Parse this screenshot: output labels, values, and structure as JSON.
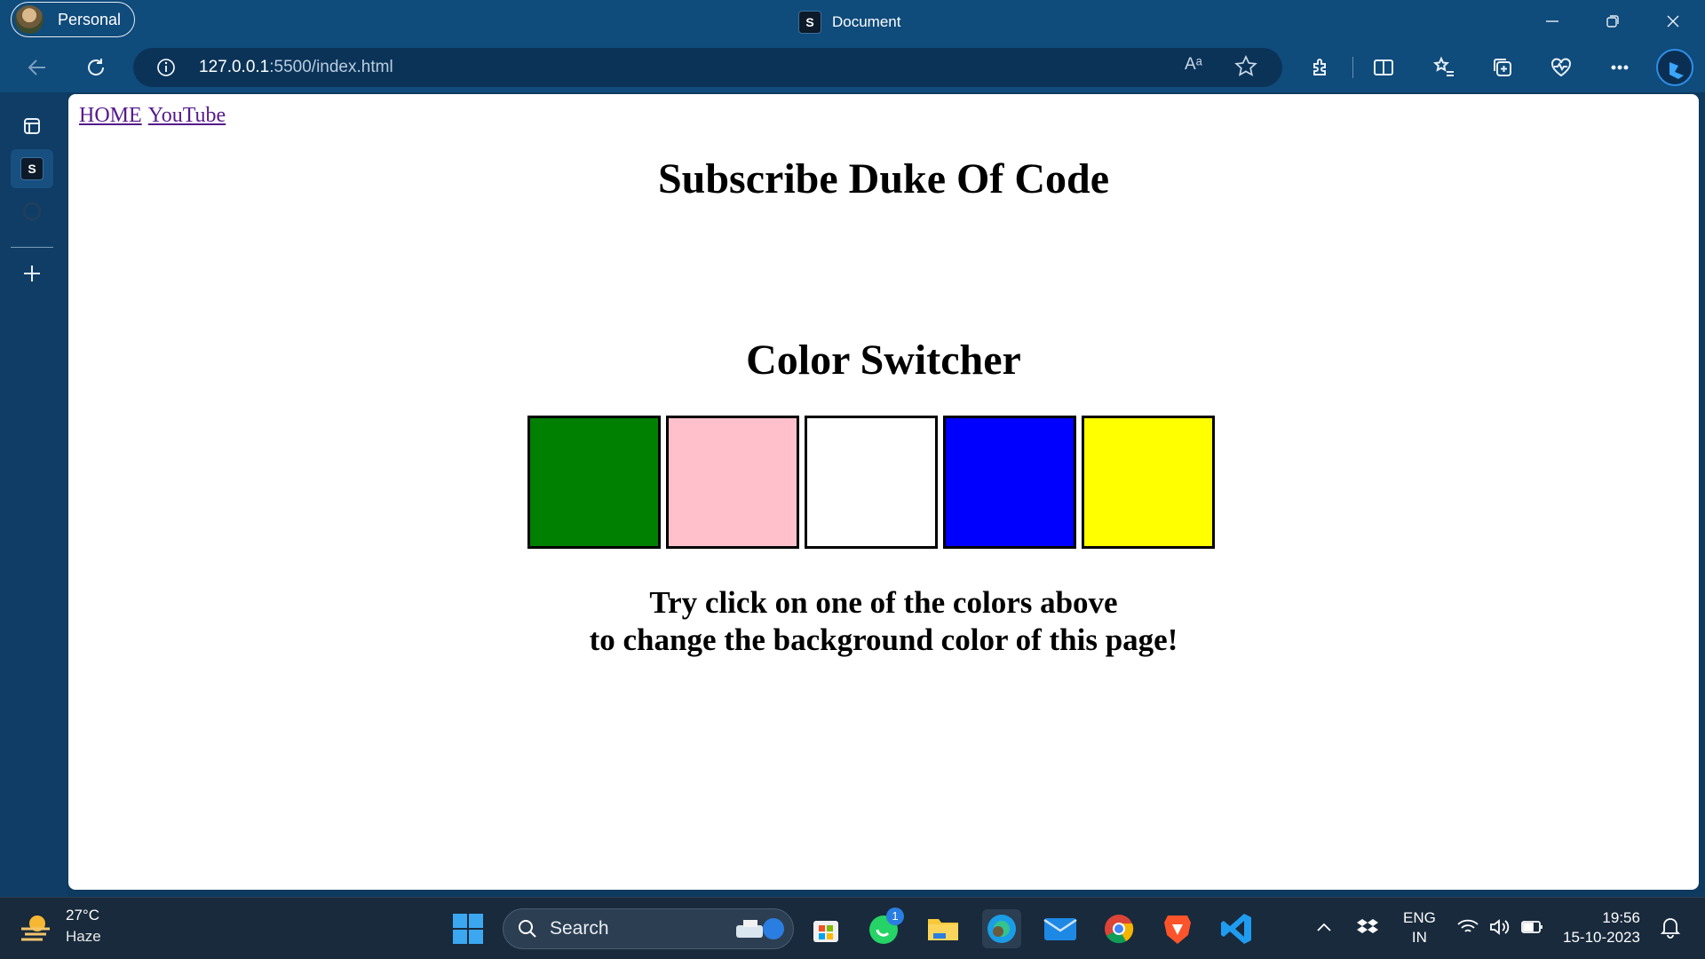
{
  "browser": {
    "profile_label": "Personal",
    "tab_title": "Document",
    "favicon_letter": "S",
    "url_host": "127.0.0.1",
    "url_rest": ":5500/index.html",
    "read_aloud_glyph": "Aᵃ"
  },
  "page": {
    "nav_links": [
      "HOME",
      "YouTube"
    ],
    "heading": "Subscribe Duke Of Code",
    "switcher_heading": "Color Switcher",
    "swatches": [
      {
        "name": "green",
        "color": "#008000"
      },
      {
        "name": "pink",
        "color": "#ffc0cb"
      },
      {
        "name": "white",
        "color": "#ffffff"
      },
      {
        "name": "blue",
        "color": "#0000ff"
      },
      {
        "name": "yellow",
        "color": "#ffff00"
      }
    ],
    "instructions_line1": "Try click on one of the colors above",
    "instructions_line2": "to change the background color of this page!"
  },
  "taskbar": {
    "weather_temp": "27°C",
    "weather_condition": "Haze",
    "search_label": "Search",
    "whatsapp_badge": "1",
    "lang_line1": "ENG",
    "lang_line2": "IN",
    "time": "19:56",
    "date": "15-10-2023"
  },
  "colors": {
    "chrome_bg": "#0f4b7b",
    "sidebar_bg": "#0f3d66",
    "taskbar_bg": "#182a3c",
    "link_visited": "#551a8b"
  }
}
